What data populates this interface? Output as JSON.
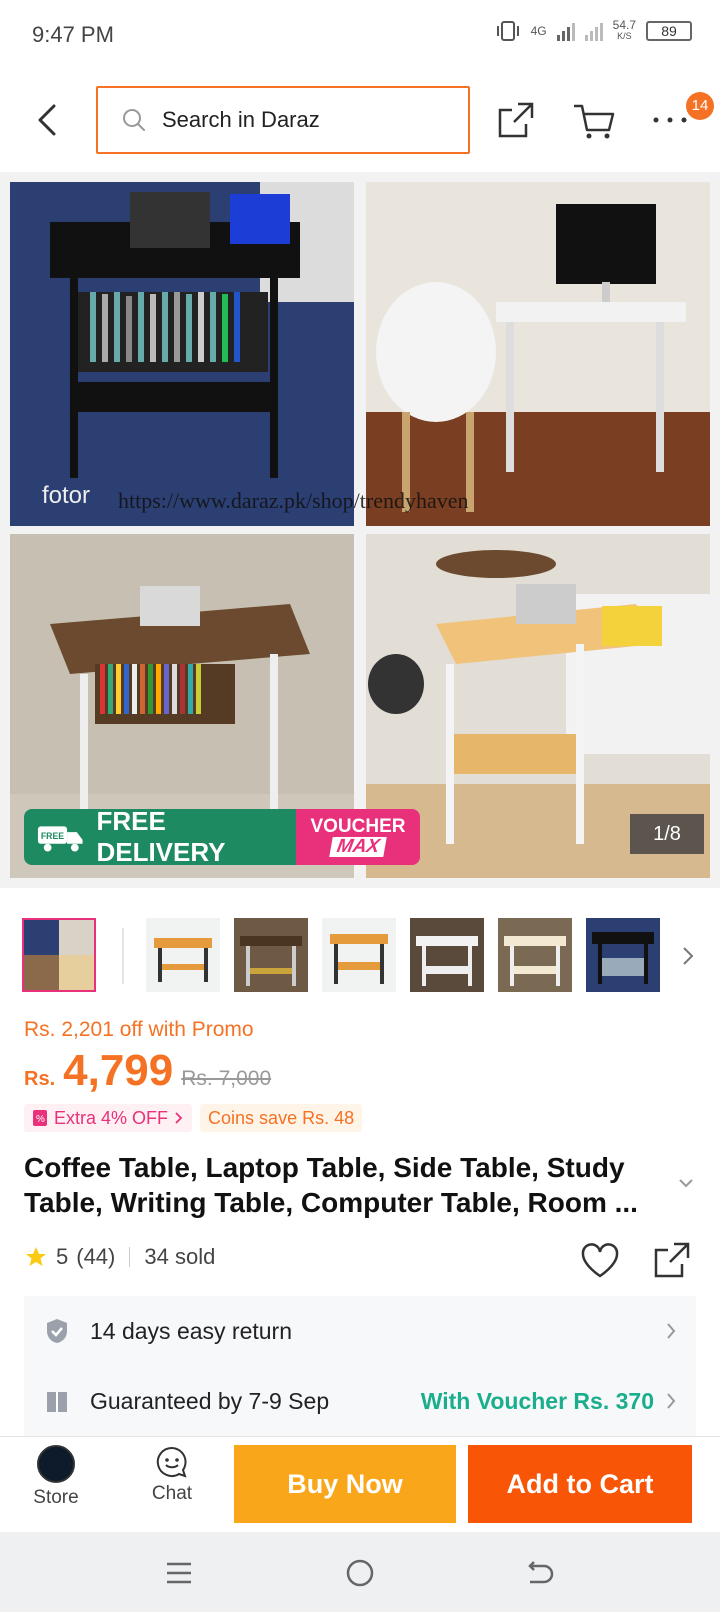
{
  "status_bar": {
    "time": "9:47 PM",
    "network_type": "4G",
    "speed": "54.7",
    "speed_unit": "K/S",
    "battery": "89"
  },
  "nav": {
    "search_placeholder": "Search in Daraz",
    "cart_badge": "14"
  },
  "gallery": {
    "watermark": "https://www.daraz.pk/shop/trendyhaven",
    "fotor_label": "fotor",
    "free_delivery": "FREE DELIVERY",
    "free_tag": "FREE",
    "voucher_line1": "VOUCHER",
    "voucher_line2": "MAX",
    "counter": "1/8"
  },
  "product": {
    "promo_text": "Rs. 2,201 off with Promo",
    "currency": "Rs.",
    "price": "4,799",
    "original_price": "Rs. 7,000",
    "extra_off": "Extra 4% OFF",
    "coins_save": "Coins save Rs. 48",
    "title": "Coffee Table, Laptop Table, Side Table, Study Table, Writing Table, Computer Table, Room ...",
    "rating": "5",
    "reviews": "(44)",
    "sold": "34 sold"
  },
  "services": {
    "return_policy": "14 days easy return",
    "delivery": "Guaranteed by 7-9 Sep",
    "voucher": "With Voucher Rs. 370"
  },
  "action_bar": {
    "store_label": "Store",
    "chat_label": "Chat",
    "buy_now": "Buy Now",
    "add_to_cart": "Add to Cart"
  },
  "colors": {
    "brand_orange": "#f57224",
    "buy_now": "#faa61a",
    "add_to_cart": "#f85606",
    "free_delivery_green": "#1d8a62",
    "voucher_pink": "#e8317a",
    "voucher_text_green": "#1aae8c"
  }
}
